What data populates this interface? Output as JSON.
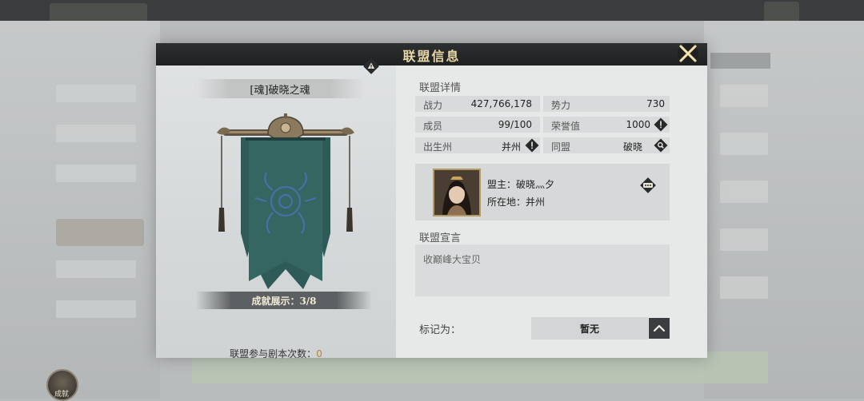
{
  "panel": {
    "title": "联盟信息"
  },
  "clan": {
    "name": "[魂]破晓之魂",
    "achievement_label": "成就展示：3/8",
    "dungeon_label": "联盟参与剧本次数：",
    "dungeon_count": "0"
  },
  "details": {
    "section_title": "联盟详情",
    "power_label": "战力",
    "power_value": "427,766,178",
    "influence_label": "势力",
    "influence_value": "730",
    "members_label": "成员",
    "members_value": "99/100",
    "honor_label": "荣誉值",
    "honor_value": "1000",
    "origin_label": "出生州",
    "origin_value": "并州",
    "alliance_label": "同盟",
    "alliance_value": "破晓"
  },
  "leader": {
    "leader_line": "盟主：破晓灬夕",
    "location_line": "所在地：并州"
  },
  "declaration": {
    "section_title": "联盟宣言",
    "text": "收巅峰大宝贝"
  },
  "mark": {
    "label": "标记为：",
    "value": "暂无"
  },
  "corner": {
    "label": "成就"
  },
  "colors": {
    "header": "#1e2022",
    "title_gold": "#e9d9a7",
    "banner_teal": "#2e5a57",
    "accent_gold": "#b5862f"
  }
}
